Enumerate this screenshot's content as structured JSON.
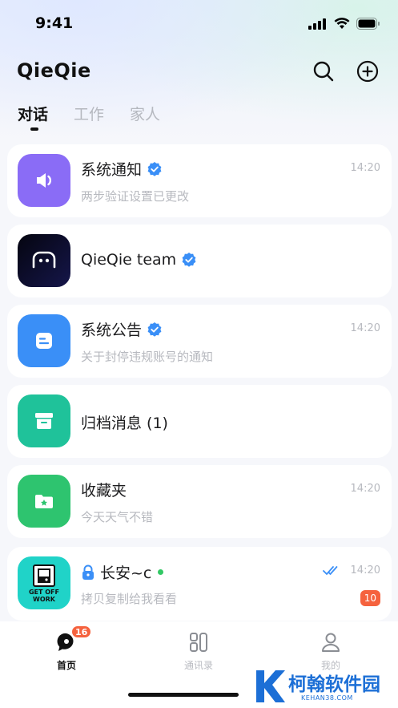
{
  "status_bar": {
    "time": "9:41"
  },
  "header": {
    "title": "QieQie"
  },
  "tabs": [
    {
      "label": "对话",
      "active": true
    },
    {
      "label": "工作",
      "active": false
    },
    {
      "label": "家人",
      "active": false
    }
  ],
  "conversations": [
    {
      "title": "系统通知",
      "subtitle": "两步验证设置已更改",
      "time": "14:20",
      "verified": true,
      "avatar_icon": "speaker-icon",
      "avatar_color": "#8a6cf6"
    },
    {
      "title": "QieQie team",
      "subtitle": "",
      "time": "",
      "verified": true,
      "avatar_icon": "qieqie-logo-icon",
      "avatar_color": "#0b0b2a"
    },
    {
      "title": "系统公告",
      "subtitle": "关于封停违规账号的通知",
      "time": "14:20",
      "verified": true,
      "avatar_icon": "announcement-icon",
      "avatar_color": "#3a8ff7"
    },
    {
      "title": "归档消息 (1)",
      "subtitle": "",
      "time": "",
      "verified": false,
      "avatar_icon": "archive-box-icon",
      "avatar_color": "#1fc29a"
    },
    {
      "title": "收藏夹",
      "subtitle": "今天天气不错",
      "time": "14:20",
      "verified": false,
      "avatar_icon": "folder-star-icon",
      "avatar_color": "#2ec46f"
    },
    {
      "title": "长安~c",
      "subtitle": "拷贝复制给我看看",
      "time": "14:20",
      "verified": false,
      "locked": true,
      "online": true,
      "read": true,
      "unread_count": "10",
      "avatar_icon": "get-off-work-sticker",
      "avatar_sticker_text": "GET OFF WORK",
      "avatar_color": "#20d3c8"
    }
  ],
  "bottom_nav": [
    {
      "label": "首页",
      "icon": "chat-bubble-icon",
      "active": true,
      "badge": "16"
    },
    {
      "label": "通讯录",
      "icon": "contacts-grid-icon",
      "active": false
    },
    {
      "label": "我的",
      "icon": "person-icon",
      "active": false
    }
  ],
  "watermark": {
    "text": "柯翰软件园",
    "sub": "KEHAN38.COM"
  },
  "colors": {
    "accent_blue": "#3a8ff7",
    "badge_red": "#f5623e",
    "online_green": "#32c864"
  }
}
